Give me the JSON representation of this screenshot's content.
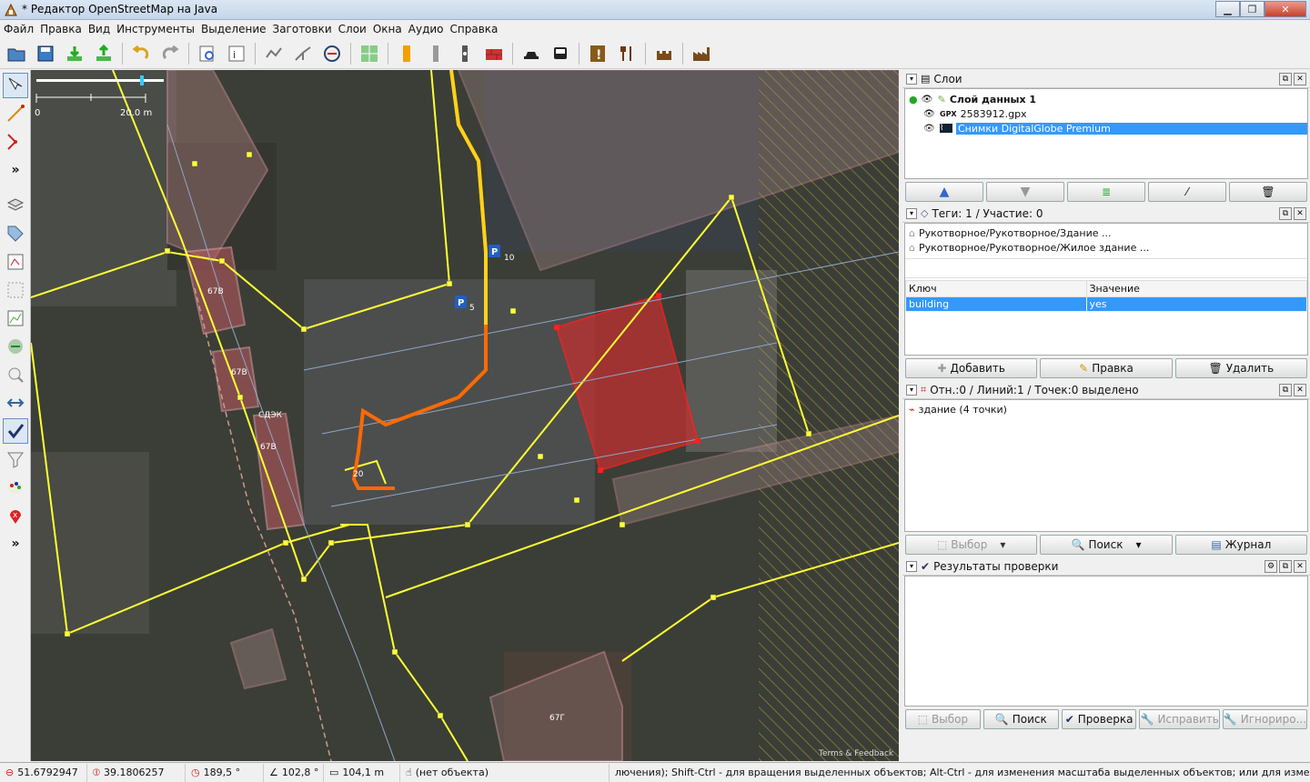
{
  "window": {
    "title": "* Редактор OpenStreetMap на Java"
  },
  "menu": [
    "Файл",
    "Правка",
    "Вид",
    "Инструменты",
    "Выделение",
    "Заготовки",
    "Слои",
    "Окна",
    "Аудио",
    "Справка"
  ],
  "map": {
    "scale_start": "0",
    "scale_end": "20.0 m",
    "labels": [
      "67В",
      "67В",
      "67В",
      "СДЭК",
      "20",
      "67Г",
      "10",
      "5"
    ],
    "attribution": "Terms & Feedback"
  },
  "layers_panel": {
    "title": "Слои",
    "items": [
      {
        "name": "Слой данных 1",
        "bold": true
      },
      {
        "name": "2583912.gpx",
        "prefix": "GPX"
      },
      {
        "name": "Снимки DigitalGlobe Premium",
        "selected": true
      }
    ]
  },
  "tags_panel": {
    "title": "Теги: 1 / Участие: 0",
    "presets": [
      "Рукотворное/Рукотворное/Здание ...",
      "Рукотворное/Рукотворное/Жилое здание ..."
    ],
    "col_key": "Ключ",
    "col_value": "Значение",
    "rows": [
      {
        "key": "building",
        "value": "yes"
      }
    ],
    "add": "Добавить",
    "edit": "Правка",
    "delete": "Удалить"
  },
  "selection_panel": {
    "title": "Отн.:0 / Линий:1 / Точек:0 выделено",
    "items": [
      "здание (4 точки)"
    ],
    "select": "Выбор",
    "search": "Поиск",
    "history": "Журнал"
  },
  "validation_panel": {
    "title": "Результаты проверки",
    "select": "Выбор",
    "search": "Поиск",
    "validate": "Проверка",
    "fix": "Исправить",
    "ignore": "Игнориро..."
  },
  "status": {
    "lat": "51.6792947",
    "lon": "39.1806257",
    "heading": "189,5 °",
    "angle": "102,8 °",
    "distance": "104,1 m",
    "object": "(нет объекта)",
    "hint": "лючения); Shift-Ctrl - для вращения выделенных объектов; Alt-Ctrl - для изменения масштаба выделенных объектов; или для изменения выделенн"
  },
  "colors": {
    "selection": "#3399ff",
    "way": "#ffff33",
    "building": "#e8a0a8",
    "selected_way": "#ff2020"
  }
}
